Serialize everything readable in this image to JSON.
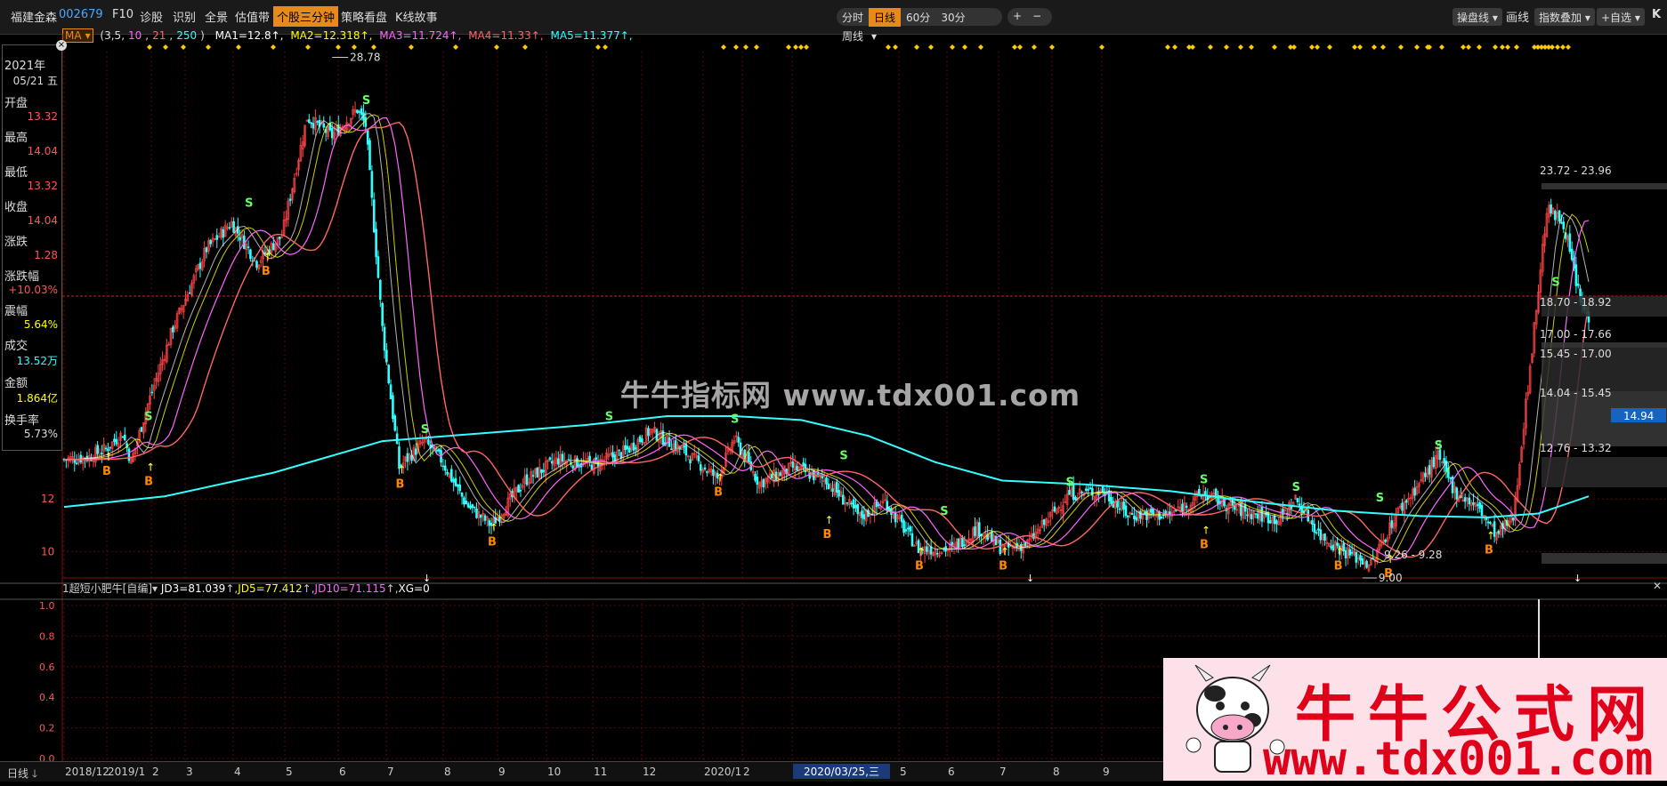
{
  "toolbar": {
    "stock_name": "福建金森",
    "stock_code": "002679",
    "menu": [
      "F10",
      "诊股",
      "识别",
      "全景",
      "估值带",
      "个股三分钟",
      "策略看盘",
      "K线故事"
    ],
    "active_menu": "个股三分钟",
    "periods": [
      "分时",
      "日线",
      "60分",
      "30分",
      "周线"
    ],
    "selected_period": "日线",
    "zoom_in": "+",
    "zoom_out": "−",
    "right_buttons": [
      "操盘线",
      "画线",
      "指数叠加",
      "+自选"
    ],
    "k_label": "K"
  },
  "ma_legend": {
    "selector": "MA",
    "params": "(3,5,10,21,250)",
    "items": [
      {
        "text": "MA1=12.8",
        "color": "#ffffff"
      },
      {
        "text": "MA2=12.318",
        "color": "#ffff00"
      },
      {
        "text": "MA3=11.724",
        "color": "#ff66ff"
      },
      {
        "text": "MA4=11.33",
        "color": "#ff6666"
      },
      {
        "text": "MA5=11.377",
        "color": "#33ffff"
      }
    ]
  },
  "info_panel": {
    "year": "2021年",
    "date": "05/21 五",
    "rows": [
      {
        "label": "开盘",
        "value": "13.32",
        "color": "#ff5555"
      },
      {
        "label": "最高",
        "value": "14.04",
        "color": "#ff5555"
      },
      {
        "label": "最低",
        "value": "13.32",
        "color": "#ff5555"
      },
      {
        "label": "收盘",
        "value": "14.04",
        "color": "#ff5555"
      },
      {
        "label": "涨跌",
        "value": "1.28",
        "color": "#ff5555"
      },
      {
        "label": "涨跌幅",
        "value": "+10.03%",
        "color": "#ff5555"
      },
      {
        "label": "震幅",
        "value": "5.64%",
        "color": "#ffff00"
      },
      {
        "label": "成交",
        "value": "13.52万",
        "color": "#33ffff"
      },
      {
        "label": "金额",
        "value": "1.864亿",
        "color": "#ffff00"
      },
      {
        "label": "换手率",
        "value": "5.73%",
        "color": "#dddddd"
      }
    ]
  },
  "chart_data": {
    "type": "line",
    "title": "",
    "xlabel": "",
    "ylabel": "",
    "ylim": [
      9,
      29
    ],
    "y_ticks": [
      12,
      10
    ],
    "x_ticks": [
      "2018/12",
      "2019/1",
      "2",
      "3",
      "4",
      "5",
      "6",
      "7",
      "8",
      "9",
      "10",
      "11",
      "12",
      "2020/1",
      "2",
      "2020/03/25,三",
      "5",
      "6",
      "7",
      "8",
      "9"
    ],
    "grid": true,
    "series": [
      {
        "name": "MA1",
        "color": "#ffffff"
      },
      {
        "name": "MA2",
        "color": "#ffff00"
      },
      {
        "name": "MA3",
        "color": "#ff66ff"
      },
      {
        "name": "MA4",
        "color": "#ff6666"
      },
      {
        "name": "MA5",
        "color": "#33ffff"
      }
    ],
    "price_path": [
      {
        "t": 0,
        "v": 13.5
      },
      {
        "t": 3,
        "v": 13.6
      },
      {
        "t": 5,
        "v": 13.9
      },
      {
        "t": 7,
        "v": 14.5
      },
      {
        "t": 8,
        "v": 13.4
      },
      {
        "t": 10,
        "v": 15.6
      },
      {
        "t": 13,
        "v": 18.5
      },
      {
        "t": 17,
        "v": 21.5
      },
      {
        "t": 20,
        "v": 22.5
      },
      {
        "t": 23,
        "v": 21.0
      },
      {
        "t": 26,
        "v": 22.0
      },
      {
        "t": 29,
        "v": 26.5
      },
      {
        "t": 32,
        "v": 25.8
      },
      {
        "t": 35,
        "v": 26.8
      },
      {
        "t": 36,
        "v": 26.2
      },
      {
        "t": 38,
        "v": 18.5
      },
      {
        "t": 40,
        "v": 13.2
      },
      {
        "t": 43,
        "v": 14.2
      },
      {
        "t": 45,
        "v": 13.5
      },
      {
        "t": 48,
        "v": 11.8
      },
      {
        "t": 51,
        "v": 11.0
      },
      {
        "t": 55,
        "v": 12.7
      },
      {
        "t": 59,
        "v": 13.5
      },
      {
        "t": 63,
        "v": 13.3
      },
      {
        "t": 67,
        "v": 13.8
      },
      {
        "t": 70,
        "v": 14.6
      },
      {
        "t": 74,
        "v": 13.8
      },
      {
        "t": 78,
        "v": 12.8
      },
      {
        "t": 80,
        "v": 14.3
      },
      {
        "t": 83,
        "v": 12.6
      },
      {
        "t": 87,
        "v": 13.2
      },
      {
        "t": 91,
        "v": 12.7
      },
      {
        "t": 95,
        "v": 11.3
      },
      {
        "t": 98,
        "v": 11.9
      },
      {
        "t": 102,
        "v": 10.1
      },
      {
        "t": 106,
        "v": 10.1
      },
      {
        "t": 109,
        "v": 10.9
      },
      {
        "t": 112,
        "v": 10.1
      },
      {
        "t": 115,
        "v": 10.3
      },
      {
        "t": 120,
        "v": 12.2
      },
      {
        "t": 124,
        "v": 12.3
      },
      {
        "t": 127,
        "v": 11.4
      },
      {
        "t": 132,
        "v": 11.4
      },
      {
        "t": 136,
        "v": 12.2
      },
      {
        "t": 140,
        "v": 11.6
      },
      {
        "t": 145,
        "v": 11.2
      },
      {
        "t": 147,
        "v": 12.0
      },
      {
        "t": 150,
        "v": 10.6
      },
      {
        "t": 153,
        "v": 10.0
      },
      {
        "t": 156,
        "v": 9.5
      },
      {
        "t": 159,
        "v": 11.4
      },
      {
        "t": 162,
        "v": 12.7
      },
      {
        "t": 164,
        "v": 13.6
      },
      {
        "t": 166,
        "v": 12.3
      },
      {
        "t": 169,
        "v": 11.6
      },
      {
        "t": 171,
        "v": 10.6
      },
      {
        "t": 173,
        "v": 11.3
      },
      {
        "t": 175,
        "v": 17.0
      },
      {
        "t": 177,
        "v": 23.0
      },
      {
        "t": 179,
        "v": 22.5
      },
      {
        "t": 181,
        "v": 19.5
      },
      {
        "t": 182,
        "v": 18.8
      }
    ],
    "ma5_path": [
      {
        "t": 0,
        "v": 11.7
      },
      {
        "t": 12,
        "v": 12.1
      },
      {
        "t": 25,
        "v": 13.0
      },
      {
        "t": 38,
        "v": 14.2
      },
      {
        "t": 50,
        "v": 14.5
      },
      {
        "t": 62,
        "v": 14.8
      },
      {
        "t": 72,
        "v": 15.15
      },
      {
        "t": 80,
        "v": 15.15
      },
      {
        "t": 88,
        "v": 15.0
      },
      {
        "t": 96,
        "v": 14.4
      },
      {
        "t": 104,
        "v": 13.4
      },
      {
        "t": 112,
        "v": 12.7
      },
      {
        "t": 122,
        "v": 12.55
      },
      {
        "t": 132,
        "v": 12.3
      },
      {
        "t": 142,
        "v": 11.9
      },
      {
        "t": 152,
        "v": 11.55
      },
      {
        "t": 162,
        "v": 11.35
      },
      {
        "t": 170,
        "v": 11.3
      },
      {
        "t": 176,
        "v": 11.45
      },
      {
        "t": 182,
        "v": 12.1
      }
    ],
    "annotations": {
      "high_label": "28.78",
      "low_label": "9.00",
      "price_bands": [
        "23.72 - 23.96",
        "18.70 - 18.92",
        "17.00 - 17.66",
        "15.45 - 17.00",
        "14.04 - 15.45",
        "12.76 - 13.32",
        "9.26 - 9.28"
      ],
      "current_price": "14.94",
      "buy_marker": "B",
      "sell_marker": "S",
      "buy_points": [
        {
          "t": 5,
          "v": 13.4
        },
        {
          "t": 10,
          "v": 13.0
        },
        {
          "t": 24,
          "v": 21.0
        },
        {
          "t": 40,
          "v": 12.9
        },
        {
          "t": 51,
          "v": 10.7
        },
        {
          "t": 78,
          "v": 12.6
        },
        {
          "t": 91,
          "v": 11.0
        },
        {
          "t": 102,
          "v": 9.8
        },
        {
          "t": 112,
          "v": 9.8
        },
        {
          "t": 136,
          "v": 10.6
        },
        {
          "t": 152,
          "v": 9.8
        },
        {
          "t": 158,
          "v": 9.5
        },
        {
          "t": 170,
          "v": 10.4
        }
      ],
      "sell_points": [
        {
          "t": 10,
          "v": 14.8
        },
        {
          "t": 22,
          "v": 22.9
        },
        {
          "t": 36,
          "v": 26.8
        },
        {
          "t": 43,
          "v": 14.3
        },
        {
          "t": 65,
          "v": 14.8
        },
        {
          "t": 80,
          "v": 14.7
        },
        {
          "t": 93,
          "v": 13.3
        },
        {
          "t": 105,
          "v": 11.2
        },
        {
          "t": 120,
          "v": 12.3
        },
        {
          "t": 136,
          "v": 12.4
        },
        {
          "t": 147,
          "v": 12.1
        },
        {
          "t": 157,
          "v": 11.7
        },
        {
          "t": 164,
          "v": 13.7
        },
        {
          "t": 178,
          "v": 19.9
        }
      ]
    }
  },
  "sub_chart": {
    "title": "1超短小肥牛[自编]",
    "items": [
      {
        "text": "JD3=81.039",
        "color": "#ffffff"
      },
      {
        "text": "JD5=77.412",
        "color": "#ffff00"
      },
      {
        "text": "JD10=71.115",
        "color": "#ff66ff"
      },
      {
        "text": "XG=0",
        "color": "#ffffff"
      }
    ],
    "y_ticks": [
      "1.0",
      "0.8",
      "0.6",
      "0.4",
      "0.2",
      "0.0"
    ]
  },
  "bottom": {
    "period_label": "日线"
  },
  "watermark": {
    "center_text": "牛牛指标网 www.tdx001.com",
    "logo_title": "牛牛公式网",
    "logo_url": "www.tdx001.com"
  }
}
